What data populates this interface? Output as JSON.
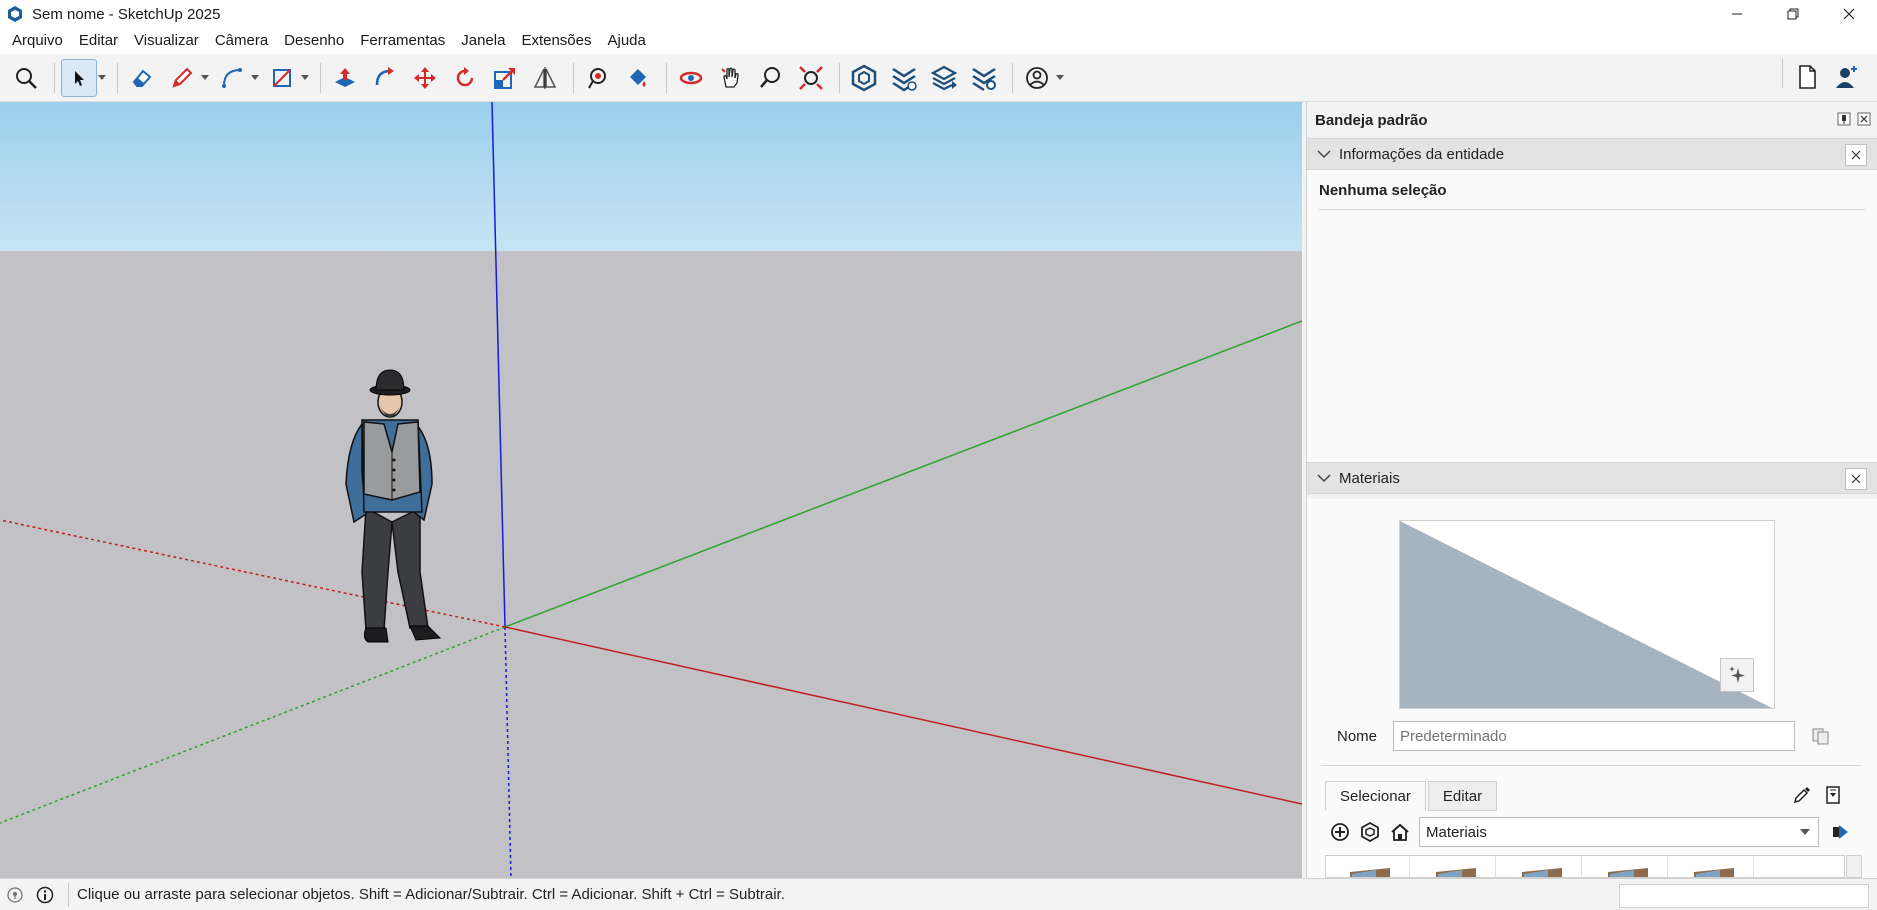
{
  "window": {
    "title": "Sem nome - SketchUp 2025",
    "app_icon": "sketchup-icon",
    "controls": [
      "minimize-icon",
      "restore-icon",
      "close-icon"
    ]
  },
  "menu": {
    "items": [
      "Arquivo",
      "Editar",
      "Visualizar",
      "Câmera",
      "Desenho",
      "Ferramentas",
      "Janela",
      "Extensões",
      "Ajuda"
    ]
  },
  "toolbar": {
    "tools": [
      "search-icon",
      "select-icon",
      "eraser-icon",
      "pencil-icon",
      "arc-icon",
      "rectangle-icon",
      "push-pull-icon",
      "follow-me-icon",
      "move-icon",
      "rotate-icon",
      "scale-icon",
      "flip-icon",
      "tape-measure-icon",
      "paint-bucket-icon",
      "orbit-icon",
      "pan-icon",
      "zoom-icon",
      "zoom-extents-icon",
      "warehouse-icon",
      "extension-icon",
      "layers-icon",
      "extension-settings-icon",
      "account-icon"
    ],
    "right_tools": [
      "new-file-icon",
      "add-user-icon"
    ],
    "colors": {
      "red": "#d42a2a",
      "blue": "#1f66b5",
      "active_bg": "#dbe8f5"
    }
  },
  "viewport": {
    "colors": {
      "sky_top": "#9ccfee",
      "sky_bottom": "#c6e4f4",
      "ground": "#c2c2c6",
      "axis_red": "#c0201e",
      "axis_green": "#2aa52a",
      "axis_blue": "#1a1adc"
    }
  },
  "tray": {
    "title": "Bandeja padrão",
    "entity_panel": {
      "title": "Informações da entidade",
      "no_selection": "Nenhuma seleção"
    },
    "materials_panel": {
      "title": "Materiais",
      "name_label": "Nome",
      "name_placeholder": "Predeterminado",
      "tabs": [
        "Selecionar",
        "Editar"
      ],
      "library": "Materiais",
      "preview_color": "#a5b4c0"
    }
  },
  "status": {
    "text": "Clique ou arraste para selecionar objetos. Shift = Adicionar/Subtrair. Ctrl = Adicionar. Shift + Ctrl = Subtrair."
  }
}
